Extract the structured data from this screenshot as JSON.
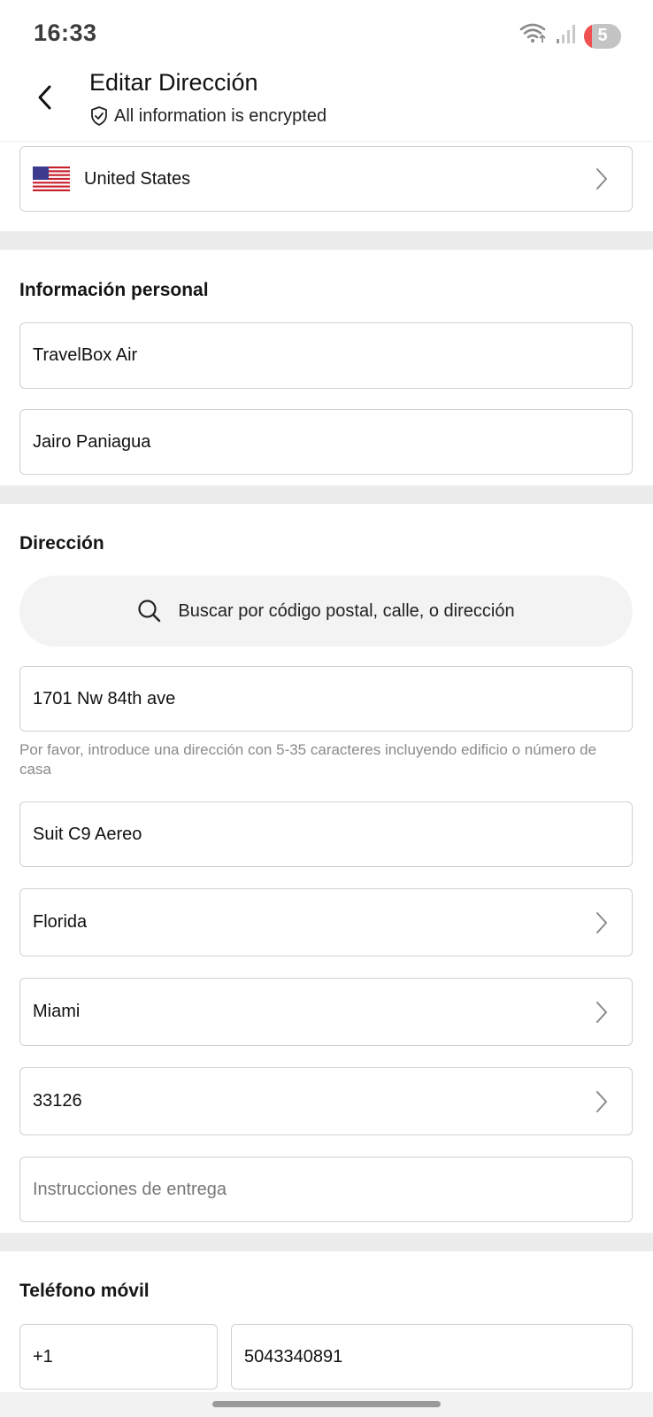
{
  "status_bar": {
    "time": "16:33",
    "battery": "5",
    "icons": [
      "wifi-icon",
      "signal-icon",
      "battery-icon"
    ]
  },
  "header": {
    "title": "Editar Dirección",
    "subtitle": "All information is encrypted"
  },
  "country": {
    "name": "United States",
    "flag": "us-flag-icon"
  },
  "personal": {
    "title": "Información personal",
    "company": "TravelBox Air",
    "name": "Jairo Paniagua"
  },
  "address": {
    "title": "Dirección",
    "search_placeholder": "Buscar por código postal, calle, o dirección",
    "line1": "1701 Nw 84th ave",
    "help": "Por favor, introduce una dirección con 5-35 caracteres incluyendo edificio o número de casa",
    "line2": "Suit C9 Aereo",
    "state": "Florida",
    "city": "Miami",
    "zip": "33126",
    "instructions_placeholder": "Instrucciones de entrega"
  },
  "phone": {
    "title": "Teléfono móvil",
    "code": "+1",
    "number": "5043340891"
  },
  "colors": {
    "border": "#d0d0d0",
    "band": "#ececec",
    "pill": "#f3f3f3",
    "help_text": "#8a8a8a",
    "battery_alert": "#f05050"
  }
}
